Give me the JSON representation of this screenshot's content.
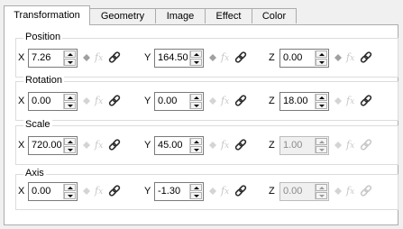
{
  "tabs": [
    {
      "label": "Transformation",
      "active": true
    },
    {
      "label": "Geometry",
      "active": false
    },
    {
      "label": "Image",
      "active": false
    },
    {
      "label": "Effect",
      "active": false
    },
    {
      "label": "Color",
      "active": false
    }
  ],
  "groups": {
    "position": {
      "title": "Position",
      "x": {
        "label": "X",
        "value": "7.26",
        "enabled": true,
        "keyframe_active": true,
        "expression_active": false
      },
      "y": {
        "label": "Y",
        "value": "164.50",
        "enabled": true,
        "keyframe_active": true,
        "expression_active": false
      },
      "z": {
        "label": "Z",
        "value": "0.00",
        "enabled": true,
        "keyframe_active": true,
        "expression_active": false
      }
    },
    "rotation": {
      "title": "Rotation",
      "x": {
        "label": "X",
        "value": "0.00",
        "enabled": true,
        "keyframe_active": false,
        "expression_active": false
      },
      "y": {
        "label": "Y",
        "value": "0.00",
        "enabled": true,
        "keyframe_active": false,
        "expression_active": false
      },
      "z": {
        "label": "Z",
        "value": "18.00",
        "enabled": true,
        "keyframe_active": false,
        "expression_active": false
      }
    },
    "scale": {
      "title": "Scale",
      "x": {
        "label": "X",
        "value": "720.00",
        "enabled": true,
        "keyframe_active": false,
        "expression_active": false
      },
      "y": {
        "label": "Y",
        "value": "45.00",
        "enabled": true,
        "keyframe_active": false,
        "expression_active": false
      },
      "z": {
        "label": "Z",
        "value": "1.00",
        "enabled": false,
        "keyframe_active": false,
        "expression_active": false
      }
    },
    "axis": {
      "title": "Axis",
      "x": {
        "label": "X",
        "value": "0.00",
        "enabled": true,
        "keyframe_active": false,
        "expression_active": false
      },
      "y": {
        "label": "Y",
        "value": "-1.30",
        "enabled": true,
        "keyframe_active": false,
        "expression_active": false
      },
      "z": {
        "label": "Z",
        "value": "0.00",
        "enabled": false,
        "keyframe_active": false,
        "expression_active": false
      }
    }
  },
  "icons": {
    "keyframe": "diamond-icon",
    "expression": "fx-icon",
    "link": "chain-link-icon"
  },
  "colors": {
    "panel_bg": "#ffffff",
    "window_bg": "#f0f0f0",
    "border": "#acacac",
    "disabled_icon": "#c8c8c8",
    "link_icon": "#2b2b2b"
  }
}
